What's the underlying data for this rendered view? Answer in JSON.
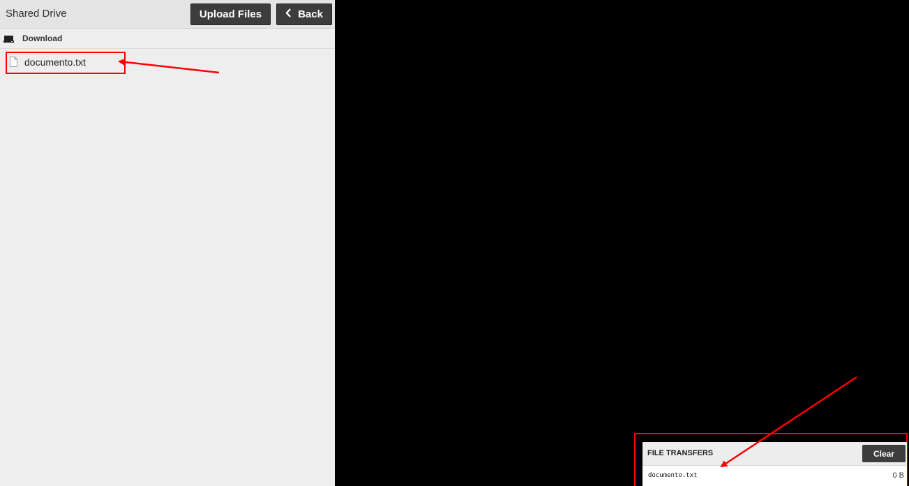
{
  "drive": {
    "title": "Shared Drive",
    "upload_label": "Upload Files",
    "back_label": "Back",
    "back_icon": "chevron-left-icon",
    "path_label": "Download",
    "files": [
      {
        "name": "documento.txt",
        "icon": "file-icon"
      }
    ]
  },
  "transfers": {
    "title": "FILE TRANSFERS",
    "clear_label": "Clear",
    "items": [
      {
        "name": "documento.txt",
        "size": "0 B"
      }
    ]
  },
  "colors": {
    "annotation_red": "#ff0000",
    "button_dark": "#3d3d3d",
    "panel_bg": "#eeeeee",
    "screen_bg": "#000000"
  }
}
